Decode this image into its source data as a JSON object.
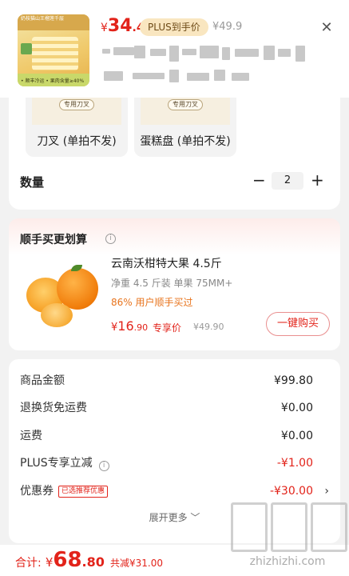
{
  "product_header": {
    "thumbnail_top_text": "奶枝猫山王榴莲千层",
    "thumbnail_bottom_text": "• 顺丰冷运  • 果肉含量≥40%",
    "price_symbol": "¥",
    "price_int": "34",
    "price_dec": ".4",
    "plus_badge": "PLUS到手价",
    "original_price": "¥49.9"
  },
  "options": [
    {
      "chip": "专用刀叉",
      "label": "刀叉 (单拍不发)"
    },
    {
      "chip": "专用刀叉",
      "label": "蛋糕盘 (单拍不发)"
    }
  ],
  "quantity": {
    "label": "数量",
    "minus": "−",
    "value": "2",
    "plus": "+"
  },
  "bundle": {
    "title": "顺手买更划算",
    "info": "i",
    "product_name": "云南沃柑特大果 4.5斤",
    "spec": "净重 4.5 斤装 单果 75MM+",
    "rate": "86% 用户顺手买过",
    "price_symbol": "¥",
    "price_int": "16",
    "price_dec": ".90",
    "price_tag": "专享价",
    "orig_price": "¥49.90",
    "buy_button": "一键购买"
  },
  "summary": {
    "rows": [
      {
        "label": "商品金额",
        "value": "¥99.80"
      },
      {
        "label": "退换货免运费",
        "value": "¥0.00"
      },
      {
        "label": "运费",
        "value": "¥0.00"
      },
      {
        "label": "PLUS专享立减",
        "value": "-¥1.00"
      },
      {
        "label": "优惠券",
        "tag": "已选推荐优惠",
        "value": "-¥30.00"
      }
    ],
    "expand": "展开更多 ﹀"
  },
  "bottom_bar": {
    "total_label": "合计:",
    "total_symbol": "¥",
    "total_int": "68",
    "total_dec": ".80",
    "saved": "共减¥31.00"
  },
  "watermark": {
    "domain": "zhizhizhi.com"
  },
  "colors": {
    "accent": "#e2231a",
    "plus_badge_bg": "#f9e6c0",
    "rate_orange": "#e8741d"
  }
}
